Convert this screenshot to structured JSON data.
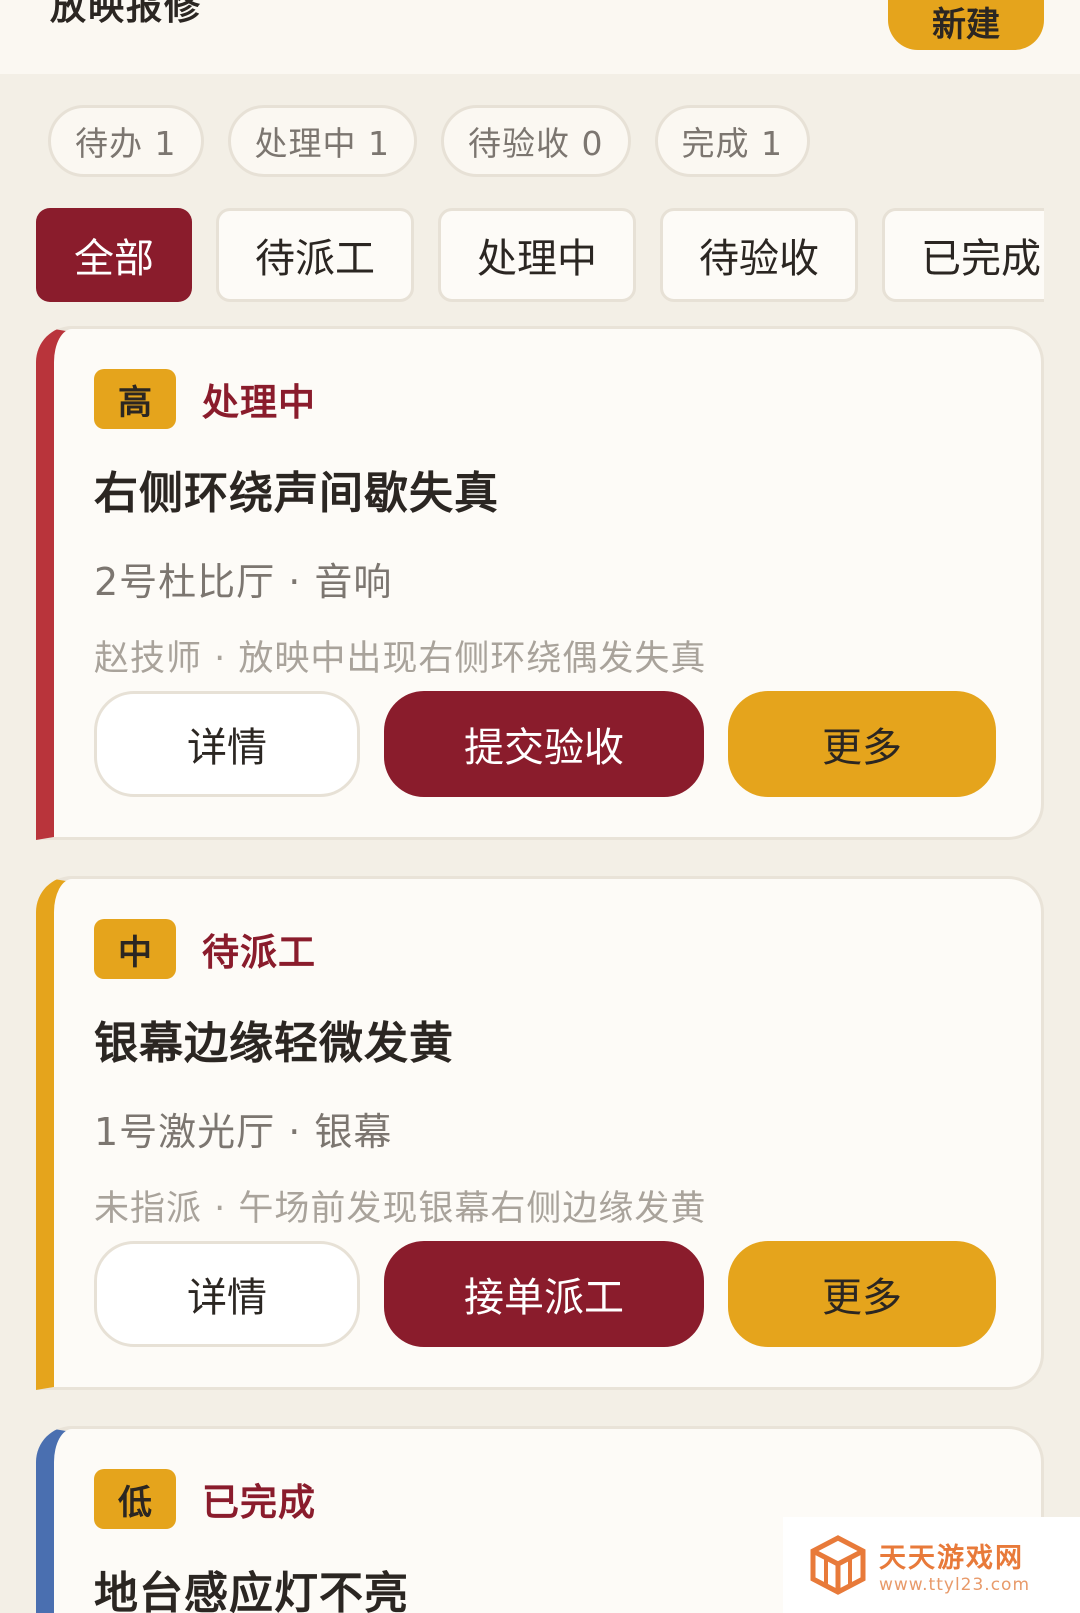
{
  "header": {
    "title": "放映报修",
    "new_label": "新建"
  },
  "stats": [
    {
      "label": "待办 1"
    },
    {
      "label": "处理中 1"
    },
    {
      "label": "待验收 0"
    },
    {
      "label": "完成 1"
    }
  ],
  "tabs": [
    {
      "label": "全部",
      "active": true
    },
    {
      "label": "待派工"
    },
    {
      "label": "处理中"
    },
    {
      "label": "待验收"
    },
    {
      "label": "已完成"
    }
  ],
  "cards": [
    {
      "priority": "高",
      "status": "处理中",
      "title": "右侧环绕声间歇失真",
      "location": "2号杜比厅 · 音响",
      "note": "赵技师 · 放映中出现右侧环绕偶发失真",
      "detail_label": "详情",
      "primary_label": "提交验收",
      "more_label": "更多",
      "accent": "#b9343b"
    },
    {
      "priority": "中",
      "status": "待派工",
      "title": "银幕边缘轻微发黄",
      "location": "1号激光厅 · 银幕",
      "note": "未指派 · 午场前发现银幕右侧边缘发黄",
      "detail_label": "详情",
      "primary_label": "接单派工",
      "more_label": "更多",
      "accent": "#e5a41c"
    },
    {
      "priority": "低",
      "status": "已完成",
      "title": "地台感应灯不亮",
      "accent": "#4a6fb0"
    }
  ],
  "watermark": {
    "name": "天天游戏网",
    "url": "www.ttyl23.com"
  },
  "colors": {
    "brand": "#8a1c2c",
    "accent": "#e5a41c",
    "background": "#f3efe6"
  }
}
